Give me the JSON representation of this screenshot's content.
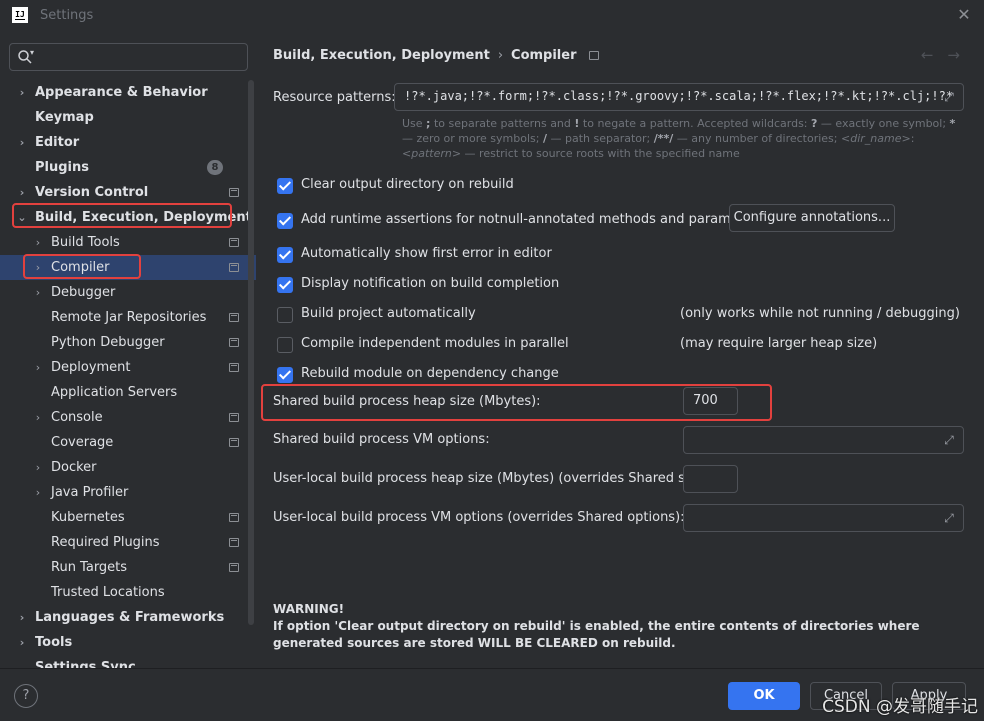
{
  "window": {
    "title": "Settings",
    "logo_text": "IJ"
  },
  "search": {
    "placeholder": ""
  },
  "tree": [
    {
      "label": "Appearance & Behavior",
      "level": 0,
      "bold": true,
      "chevron": "›",
      "pin": false
    },
    {
      "label": "Keymap",
      "level": 0,
      "bold": true,
      "chevron": "",
      "pin": false
    },
    {
      "label": "Editor",
      "level": 0,
      "bold": true,
      "chevron": "›",
      "pin": false
    },
    {
      "label": "Plugins",
      "level": 0,
      "bold": true,
      "chevron": "",
      "pin": false,
      "badge": "8"
    },
    {
      "label": "Version Control",
      "level": 0,
      "bold": true,
      "chevron": "›",
      "pin": true
    },
    {
      "label": "Build, Execution, Deployment",
      "level": 0,
      "bold": true,
      "chevron": "⌄",
      "pin": false
    },
    {
      "label": "Build Tools",
      "level": 1,
      "bold": false,
      "chevron": "›",
      "pin": true
    },
    {
      "label": "Compiler",
      "level": 1,
      "bold": false,
      "chevron": "›",
      "pin": true,
      "selected": true
    },
    {
      "label": "Debugger",
      "level": 1,
      "bold": false,
      "chevron": "›",
      "pin": false
    },
    {
      "label": "Remote Jar Repositories",
      "level": 1,
      "bold": false,
      "chevron": "",
      "pin": true
    },
    {
      "label": "Python Debugger",
      "level": 1,
      "bold": false,
      "chevron": "",
      "pin": true
    },
    {
      "label": "Deployment",
      "level": 1,
      "bold": false,
      "chevron": "›",
      "pin": true
    },
    {
      "label": "Application Servers",
      "level": 1,
      "bold": false,
      "chevron": "",
      "pin": false
    },
    {
      "label": "Console",
      "level": 1,
      "bold": false,
      "chevron": "›",
      "pin": true
    },
    {
      "label": "Coverage",
      "level": 1,
      "bold": false,
      "chevron": "",
      "pin": true
    },
    {
      "label": "Docker",
      "level": 1,
      "bold": false,
      "chevron": "›",
      "pin": false
    },
    {
      "label": "Java Profiler",
      "level": 1,
      "bold": false,
      "chevron": "›",
      "pin": false
    },
    {
      "label": "Kubernetes",
      "level": 1,
      "bold": false,
      "chevron": "",
      "pin": true
    },
    {
      "label": "Required Plugins",
      "level": 1,
      "bold": false,
      "chevron": "",
      "pin": true
    },
    {
      "label": "Run Targets",
      "level": 1,
      "bold": false,
      "chevron": "",
      "pin": true
    },
    {
      "label": "Trusted Locations",
      "level": 1,
      "bold": false,
      "chevron": "",
      "pin": false
    },
    {
      "label": "Languages & Frameworks",
      "level": 0,
      "bold": true,
      "chevron": "›",
      "pin": false
    },
    {
      "label": "Tools",
      "level": 0,
      "bold": true,
      "chevron": "›",
      "pin": false
    },
    {
      "label": "Settings Sync",
      "level": 0,
      "bold": true,
      "chevron": "",
      "pin": false
    }
  ],
  "breadcrumb": {
    "parent": "Build, Execution, Deployment",
    "separator": "›",
    "current": "Compiler"
  },
  "nav": {
    "back": "←",
    "forward": "→"
  },
  "resource_patterns": {
    "label": "Resource patterns:",
    "value": "!?*.java;!?*.form;!?*.class;!?*.groovy;!?*.scala;!?*.flex;!?*.kt;!?*.clj;!?*",
    "hint_html": "Use <b>;</b> to separate patterns and <b>!</b> to negate a pattern. Accepted wildcards: <b>?</b> — exactly one symbol; <b>*</b> — zero or more symbols; <b>/</b> — path separator; <b>/**/</b> — any number of directories; <i>&lt;dir_name&gt;</i>:<i>&lt;pattern&gt;</i> — restrict to source roots with the specified name"
  },
  "options": [
    {
      "label": "Clear output directory on rebuild",
      "checked": true
    },
    {
      "label": "Add runtime assertions for notnull-annotated methods and parameters",
      "checked": true,
      "button": "Configure annotations..."
    },
    {
      "label": "Automatically show first error in editor",
      "checked": true
    },
    {
      "label": "Display notification on build completion",
      "checked": true
    },
    {
      "label": "Build project automatically",
      "checked": false,
      "note": "(only works while not running / debugging)"
    },
    {
      "label": "Compile independent modules in parallel",
      "checked": false,
      "note": "(may require larger heap size)"
    },
    {
      "label": "Rebuild module on dependency change",
      "checked": true
    }
  ],
  "fields": {
    "shared_heap": {
      "label": "Shared build process heap size (Mbytes):",
      "value": "700"
    },
    "shared_vm": {
      "label": "Shared build process VM options:",
      "value": ""
    },
    "local_heap": {
      "label": "User-local build process heap size (Mbytes) (overrides Shared size):",
      "value": ""
    },
    "local_vm": {
      "label": "User-local build process VM options (overrides Shared options):",
      "value": ""
    }
  },
  "warning": {
    "title": "WARNING!",
    "text": "If option 'Clear output directory on rebuild' is enabled, the entire contents of directories where generated sources are stored WILL BE CLEARED on rebuild."
  },
  "footer": {
    "help": "?",
    "ok": "OK",
    "cancel": "Cancel",
    "apply": "Apply"
  },
  "watermark": "CSDN @发哥随手记",
  "colors": {
    "accent": "#3574f0",
    "selection": "#2e436e",
    "highlight_box": "#e2413e",
    "background": "#2b2d30"
  }
}
